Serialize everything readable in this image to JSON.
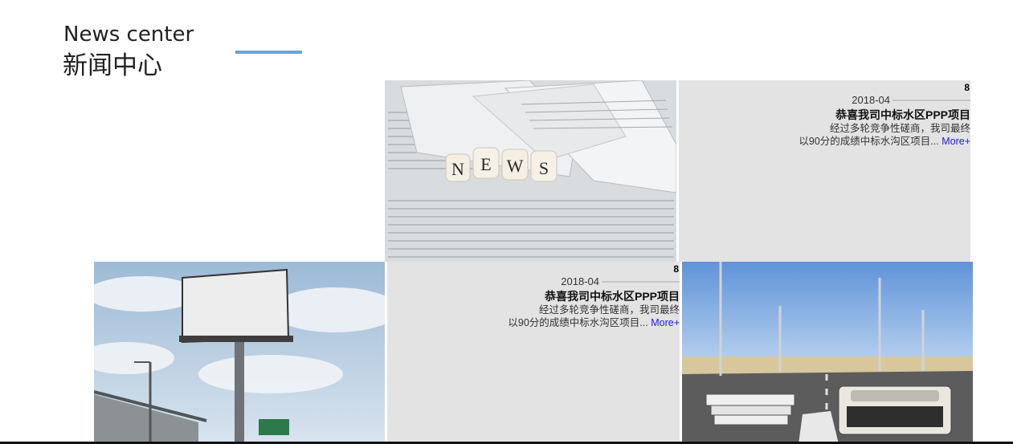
{
  "section": {
    "title_en": "News center",
    "title_cn": "新闻中心",
    "accent_color": "#6aa3d3"
  },
  "grid": {
    "image_1": {
      "icon": "newspaper-news-photo",
      "letters": [
        "N",
        "E",
        "W",
        "S"
      ]
    },
    "image_2": {
      "icon": "billboard-photo"
    },
    "image_3": {
      "icon": "road-typewriter-books-photo"
    },
    "news": [
      {
        "day": "8",
        "date": "2018-04",
        "headline": "恭喜我司中标水区PPP项目",
        "summary_line1": "经过多轮竞争性磋商，我司最终",
        "summary_line2": "以90分的成绩中标水沟区项目...",
        "more": "More+"
      },
      {
        "day": "8",
        "date": "2018-04",
        "headline": "恭喜我司中标水区PPP项目",
        "summary_line1": "经过多轮竞争性磋商，我司最终",
        "summary_line2": "以90分的成绩中标水沟区项目...",
        "more": "More+"
      }
    ]
  }
}
